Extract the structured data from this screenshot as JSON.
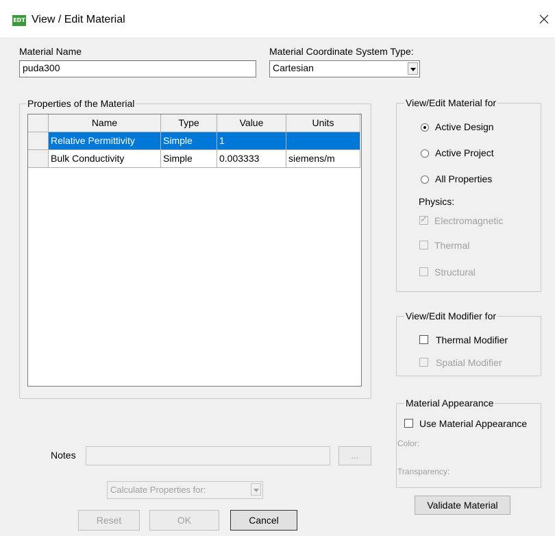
{
  "window": {
    "title": "View / Edit Material",
    "icon_text": "EDT"
  },
  "material_name": {
    "label": "Material Name",
    "value": "puda300"
  },
  "coord_system": {
    "label": "Material Coordinate System Type:",
    "value": "Cartesian"
  },
  "properties": {
    "legend": "Properties of the Material",
    "columns": [
      "Name",
      "Type",
      "Value",
      "Units"
    ],
    "rows": [
      {
        "name": "Relative Permittivity",
        "type": "Simple",
        "value": "1",
        "units": "",
        "selected": true
      },
      {
        "name": "Bulk Conductivity",
        "type": "Simple",
        "value": "0.003333",
        "units": "siemens/m",
        "selected": false
      }
    ]
  },
  "view_edit_for": {
    "legend": "View/Edit Material for",
    "options": [
      "Active Design",
      "Active Project",
      "All Properties"
    ],
    "selected": "Active Design",
    "physics_label": "Physics:",
    "physics": [
      {
        "label": "Electromagnetic",
        "checked": true
      },
      {
        "label": "Thermal",
        "checked": false
      },
      {
        "label": "Structural",
        "checked": false
      }
    ]
  },
  "modifier": {
    "legend": "View/Edit Modifier for",
    "thermal": "Thermal Modifier",
    "spatial": "Spatial Modifier"
  },
  "appearance": {
    "legend": "Material Appearance",
    "use_label": "Use Material Appearance",
    "color_label": "Color:",
    "transparency_label": "Transparency:"
  },
  "notes": {
    "label": "Notes",
    "value": "",
    "browse": "..."
  },
  "calculate": {
    "value": "Calculate Properties for:"
  },
  "buttons": {
    "reset": "Reset",
    "ok": "OK",
    "cancel": "Cancel",
    "validate": "Validate Material"
  }
}
